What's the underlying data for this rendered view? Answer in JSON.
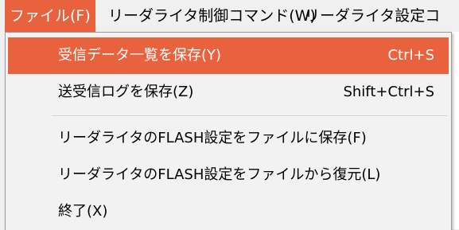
{
  "menubar": {
    "file": "ファイル(F)",
    "control": "リーダライタ制御コマンド(W)",
    "settings": "リーダライタ設定コ"
  },
  "file_menu": {
    "items": [
      {
        "label": "受信データ一覧を保存(Y)",
        "shortcut": "Ctrl+S"
      },
      {
        "label": "送受信ログを保存(Z)",
        "shortcut": "Shift+Ctrl+S"
      },
      {
        "label": "リーダライタのFLASH設定をファイルに保存(F)",
        "shortcut": ""
      },
      {
        "label": "リーダライタのFLASH設定をファイルから復元(L)",
        "shortcut": ""
      },
      {
        "label": "終了(X)",
        "shortcut": ""
      }
    ]
  },
  "colors": {
    "highlight": "#e8623e",
    "menu_background": "#f2f2f2"
  }
}
